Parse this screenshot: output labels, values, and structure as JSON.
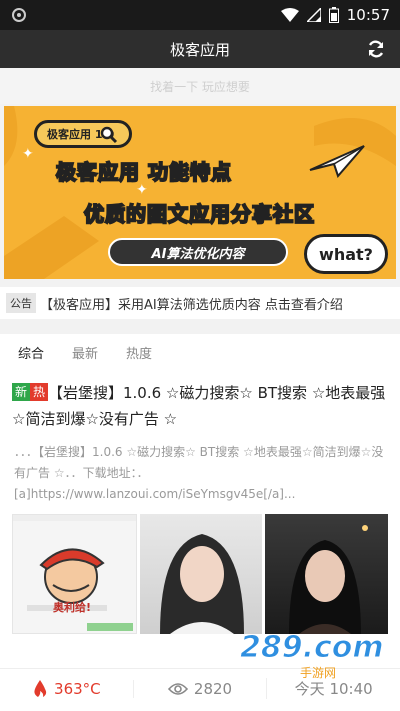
{
  "status_bar": {
    "time": "10:57",
    "icons": [
      "wifi-icon",
      "signal-icon",
      "battery-icon"
    ]
  },
  "app_bar": {
    "title": "极客应用",
    "refresh_icon": "refresh-icon"
  },
  "search": {
    "placeholder": "找着一下 玩应想要"
  },
  "banner": {
    "badge_text": "极客应用 1.0",
    "headline_1": "极客应用 功能特点",
    "headline_2": "优质的图文应用分享社区",
    "pill_text": "AI算法优化内容",
    "bubble_text": "what?",
    "bg_color": "#f6b233"
  },
  "notice": {
    "tag": "公告",
    "text": "【极客应用】采用AI算法筛选优质内容 点击查看介绍"
  },
  "tabs": [
    {
      "label": "综合",
      "active": true
    },
    {
      "label": "最新",
      "active": false
    },
    {
      "label": "热度",
      "active": false
    }
  ],
  "post": {
    "tag_new": "新",
    "tag_hot": "热",
    "title": "【岩堡搜】1.0.6 ☆磁力搜索☆ BT搜索 ☆地表最强☆简洁到爆☆没有广告 ☆",
    "description": "．．．【岩堡搜】1.0.6 ☆磁力搜索☆ BT搜索 ☆地表最强☆简洁到爆☆没有广告 ☆．．下载地址：．[a]https://www.lanzoui.com/iSeYmsgv45e[/a]...",
    "thumb_1_caption": "奥利给!",
    "heat": "363°C",
    "views": "2820",
    "time": "今天 10:40"
  },
  "watermark": {
    "number": "289.com",
    "sub": "手游网"
  }
}
